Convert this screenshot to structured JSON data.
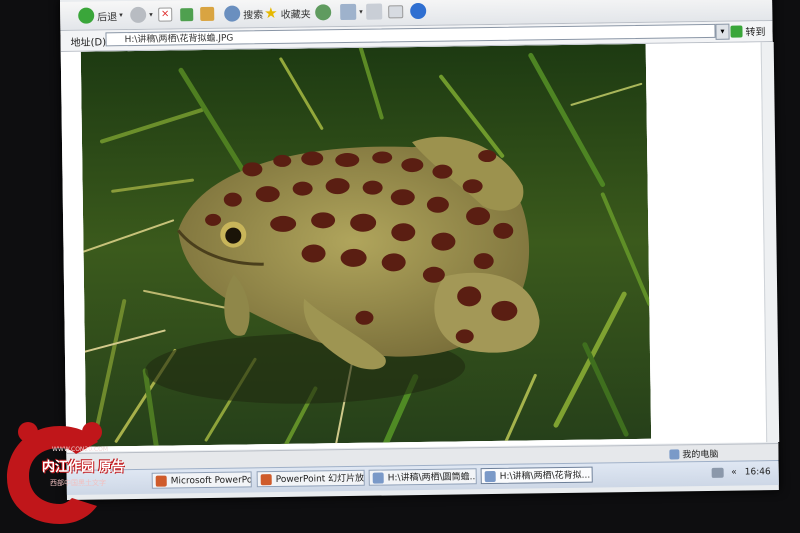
{
  "toolbar": {
    "back": "后退",
    "search": "搜索",
    "favorites": "收藏夹"
  },
  "address": {
    "label": "地址(D)",
    "value": "H:\\讲稿\\两栖\\花背拟蟾.JPG",
    "go": "转到"
  },
  "status": {
    "zone": "我的电脑"
  },
  "taskbar": {
    "tasks": [
      "Microsoft PowerPoin...",
      "PowerPoint 幻灯片放...",
      "H:\\讲稿\\两栖\\圆筒蟾...",
      "H:\\讲稿\\两栖\\花背拟..."
    ],
    "tray_chevron": "«",
    "clock": "16:46"
  },
  "watermark": {
    "site": "WWW.CON20.COM",
    "brand": "内江作园 原告",
    "sub": "西部中国黑土文字"
  },
  "colors": {
    "toolbar": "#e3e6ea",
    "screen_bg": "#0e0e10",
    "watermark_red": "#c0161a"
  }
}
